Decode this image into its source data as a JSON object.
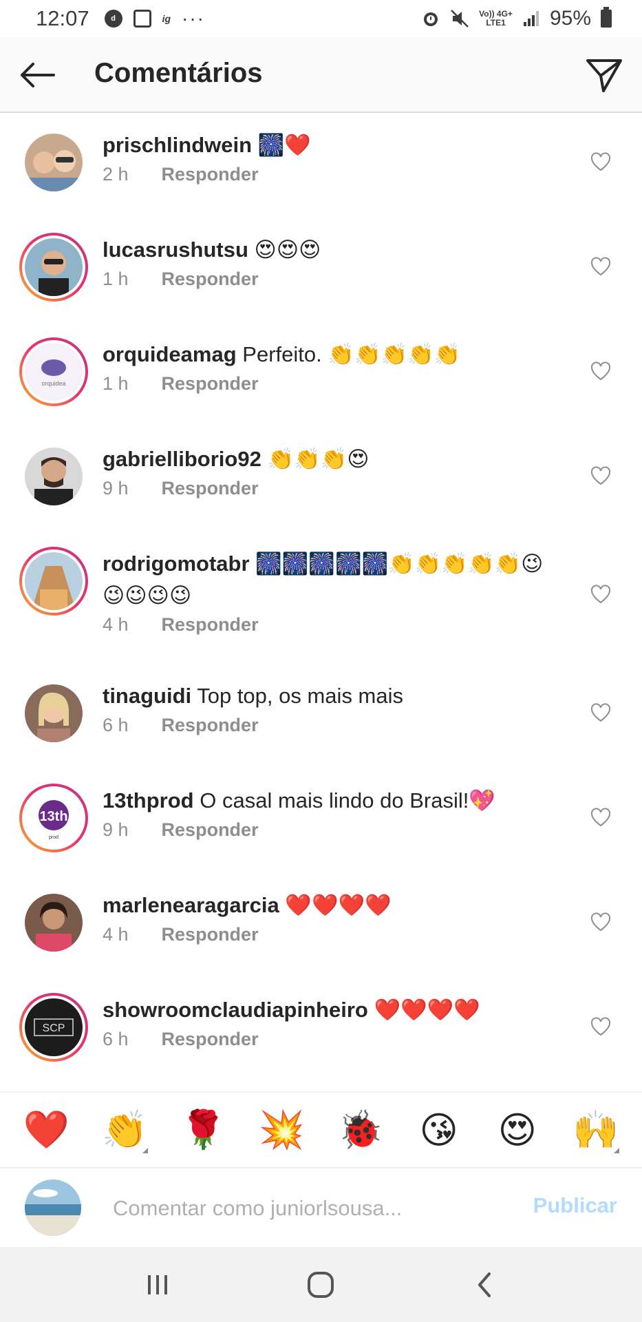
{
  "status_bar": {
    "time": "12:07",
    "icons": [
      "dm-icon",
      "gallery-icon",
      "notification-icon"
    ],
    "dots": "···",
    "network_top": "Vo)) 4G+",
    "network_bottom": "LTE1",
    "battery": "95%"
  },
  "header": {
    "title": "Comentários",
    "back_icon": "arrow-left-icon",
    "send_icon": "paper-plane-icon"
  },
  "comments": [
    {
      "username": "prischlindwein",
      "text": "🎆❤️",
      "time": "2 h",
      "reply": "Responder",
      "story": false,
      "avatar_color": "#c9a98e"
    },
    {
      "username": "lucasrushutsu",
      "text": "😍😍😍",
      "time": "1 h",
      "reply": "Responder",
      "story": true,
      "avatar_color": "#8fb3c9"
    },
    {
      "username": "orquideamag",
      "text": "Perfeito. 👏👏👏👏👏",
      "time": "1 h",
      "reply": "Responder",
      "story": true,
      "avatar_color": "#e4e0ee"
    },
    {
      "username": "gabrielliborio92",
      "text": "👏👏👏😍",
      "time": "9 h",
      "reply": "Responder",
      "story": false,
      "avatar_color": "#5a4a44"
    },
    {
      "username": "rodrigomotabr",
      "text": "🎆🎆🎆🎆🎆👏👏👏👏👏😉😉😉😉😉",
      "time": "4 h",
      "reply": "Responder",
      "story": true,
      "avatar_color": "#c8a57a"
    },
    {
      "username": "tinaguidi",
      "text": "Top top, os mais mais",
      "time": "6 h",
      "reply": "Responder",
      "story": false,
      "avatar_color": "#b89a86"
    },
    {
      "username": "13thprod",
      "text": "O casal mais lindo do Brasil!💖",
      "time": "9 h",
      "reply": "Responder",
      "story": true,
      "avatar_color": "#ffffff"
    },
    {
      "username": "marlenearagarcia",
      "text": "❤️❤️❤️❤️",
      "time": "4 h",
      "reply": "Responder",
      "story": false,
      "avatar_color": "#7a5a4a"
    },
    {
      "username": "showroomclaudiapinheiro",
      "text": "❤️❤️❤️❤️",
      "time": "6 h",
      "reply": "Responder",
      "story": true,
      "avatar_color": "#1c1c1c"
    }
  ],
  "avatar_texts": {
    "orquideamag": "orquidea",
    "13thprod": "13th",
    "showroomclaudiapinheiro": "SCP"
  },
  "quick_emojis": [
    "❤️",
    "👏",
    "🌹",
    "💥",
    "🐞",
    "😘",
    "😍",
    "🙌"
  ],
  "input": {
    "placeholder": "Comentar como juniorlsousa...",
    "publish_label": "Publicar"
  },
  "nav": {
    "recent_icon": "recent-apps-icon",
    "home_icon": "home-icon",
    "back_icon": "nav-back-icon"
  },
  "colors": {
    "story_gradient_start": "#f9b42c",
    "story_gradient_end": "#c13584",
    "publish_disabled": "#b3dbff",
    "secondary_text": "#8e8e8e"
  }
}
